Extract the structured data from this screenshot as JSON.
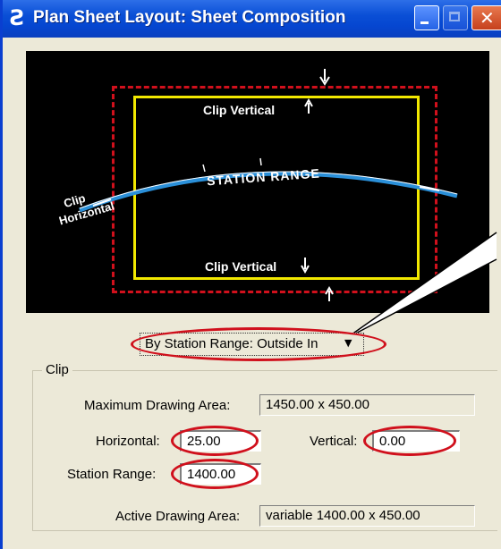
{
  "window": {
    "title": "Plan Sheet Layout: Sheet Composition",
    "icon": "bentley-b-icon"
  },
  "preview": {
    "clip_vertical_top": "Clip Vertical",
    "clip_vertical_bottom": "Clip Vertical",
    "station_range": "STATION RANGE",
    "clip_horizontal_1": "Clip",
    "clip_horizontal_2": "Horizontal"
  },
  "dropdown": {
    "value": "By Station Range: Outside In"
  },
  "clip": {
    "group_label": "Clip",
    "max_area_label": "Maximum Drawing Area:",
    "max_area_value": "1450.00 x  450.00",
    "horizontal_label": "Horizontal:",
    "horizontal_value": "25.00",
    "vertical_label": "Vertical:",
    "vertical_value": "0.00",
    "station_range_label": "Station Range:",
    "station_range_value": "1400.00",
    "active_area_label": "Active Drawing Area:",
    "active_area_value": "variable  1400.00 x  450.00"
  },
  "colors": {
    "annotation_red": "#d0101c",
    "clip_yellow": "#f2e800",
    "alignment_blue": "#2a8fd8"
  }
}
